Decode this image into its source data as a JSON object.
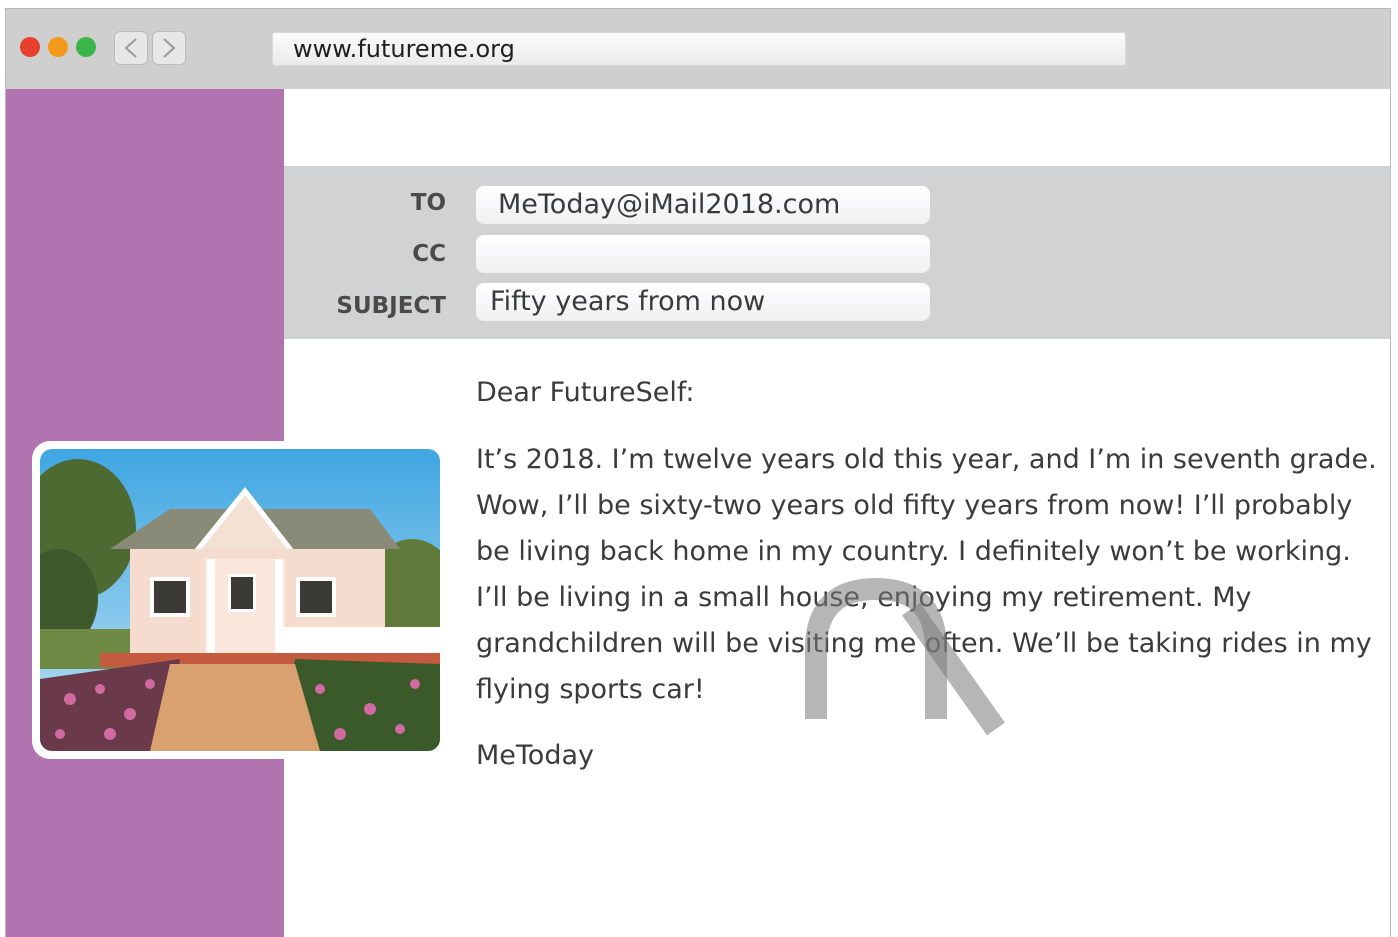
{
  "browser": {
    "url": "www.futureme.org",
    "icons": [
      "close-dot",
      "minimize-dot",
      "zoom-dot",
      "back-arrow-icon",
      "forward-arrow-icon"
    ]
  },
  "email": {
    "to_label": "TO",
    "to_value": "MeToday@iMail2018.com",
    "cc_label": "CC",
    "cc_value": "",
    "subject_label": "SUBJECT",
    "subject_value": "Fifty years from now",
    "greeting": "Dear FutureSelf:",
    "body": "It’s 2018. I’m twelve years old this year, and I’m in seventh grade. Wow, I’ll be sixty-two years old fifty years from now! I’ll probably be living back home in my country. I definitely won’t be working. I’ll be living in a small house, enjoying my retirement. My grandchildren will be visiting me often. We’ll be taking rides in my flying sports car!",
    "signature": "MeToday"
  },
  "colors": {
    "sidebar": "#b273b1",
    "header_band": "#d1d2d4",
    "close": "#e8402e",
    "minimize": "#f39a1d",
    "zoom": "#3bb54a"
  }
}
